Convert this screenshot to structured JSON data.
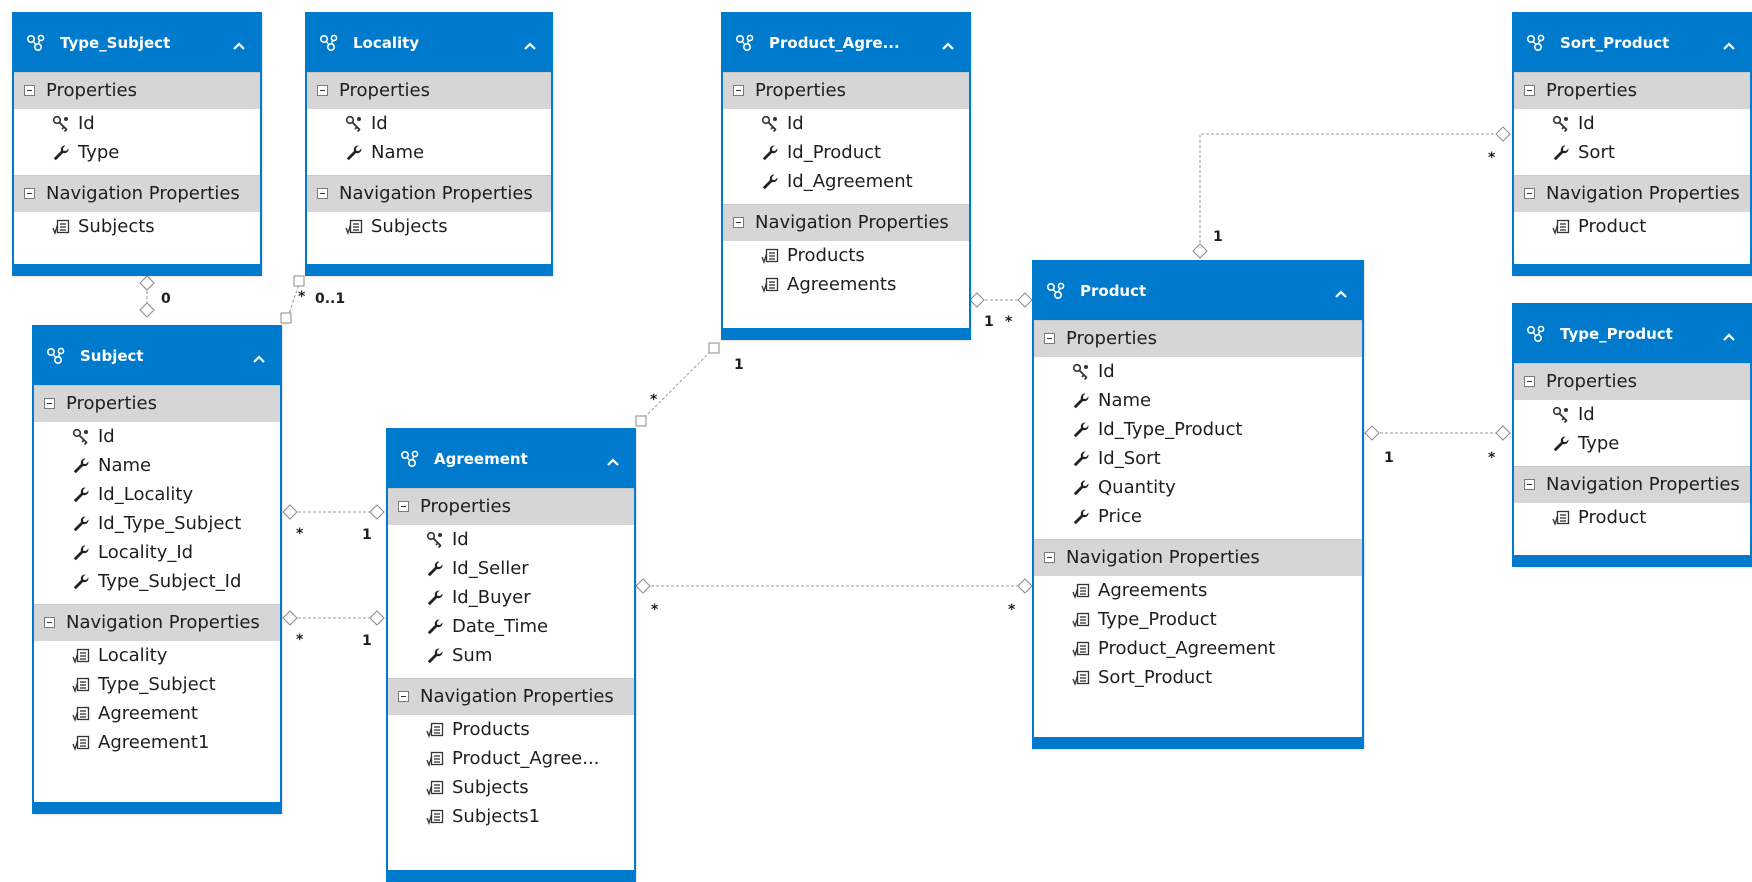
{
  "colors": {
    "accent": "#007acc",
    "section_bg": "#d6d6d6",
    "connector": "#9a9a9a"
  },
  "entities": {
    "Type_Subject": {
      "title": "Type_Subject",
      "properties_label": "Properties",
      "properties": [
        "Id",
        "Type"
      ],
      "navigation_label": "Navigation Properties",
      "navigation": [
        "Subjects"
      ]
    },
    "Locality": {
      "title": "Locality",
      "properties_label": "Properties",
      "properties": [
        "Id",
        "Name"
      ],
      "navigation_label": "Navigation Properties",
      "navigation": [
        "Subjects"
      ]
    },
    "Product_Agreement": {
      "title": "Product_Agre...",
      "properties_label": "Properties",
      "properties": [
        "Id",
        "Id_Product",
        "Id_Agreement"
      ],
      "navigation_label": "Navigation Properties",
      "navigation": [
        "Products",
        "Agreements"
      ]
    },
    "Sort_Product": {
      "title": "Sort_Product",
      "properties_label": "Properties",
      "properties": [
        "Id",
        "Sort"
      ],
      "navigation_label": "Navigation Properties",
      "navigation": [
        "Product"
      ]
    },
    "Subject": {
      "title": "Subject",
      "properties_label": "Properties",
      "properties": [
        "Id",
        "Name",
        "Id_Locality",
        "Id_Type_Subject",
        "Locality_Id",
        "Type_Subject_Id"
      ],
      "navigation_label": "Navigation Properties",
      "navigation": [
        "Locality",
        "Type_Subject",
        "Agreement",
        "Agreement1"
      ]
    },
    "Agreement": {
      "title": "Agreement",
      "properties_label": "Properties",
      "properties": [
        "Id",
        "Id_Seller",
        "Id_Buyer",
        "Date_Time",
        "Sum"
      ],
      "navigation_label": "Navigation Properties",
      "navigation": [
        "Products",
        "Product_Agree...",
        "Subjects",
        "Subjects1"
      ]
    },
    "Product": {
      "title": "Product",
      "properties_label": "Properties",
      "properties": [
        "Id",
        "Name",
        "Id_Type_Product",
        "Id_Sort",
        "Quantity",
        "Price"
      ],
      "navigation_label": "Navigation Properties",
      "navigation": [
        "Agreements",
        "Type_Product",
        "Product_Agreement",
        "Sort_Product"
      ]
    },
    "Type_Product": {
      "title": "Type_Product",
      "properties_label": "Properties",
      "properties": [
        "Id",
        "Type"
      ],
      "navigation_label": "Navigation Properties",
      "navigation": [
        "Product"
      ]
    }
  },
  "associations": [
    {
      "from": "Type_Subject",
      "to": "Subject",
      "from_mult": "",
      "to_mult": "0"
    },
    {
      "from": "Locality",
      "to": "Subject",
      "from_mult": "0..1",
      "to_mult": "*"
    },
    {
      "from": "Subject",
      "to": "Agreement",
      "from_mult": "*",
      "to_mult": "1"
    },
    {
      "from": "Subject",
      "to": "Agreement",
      "from_mult": "*",
      "to_mult": "1"
    },
    {
      "from": "Agreement",
      "to": "Product_Agreement",
      "from_mult": "*",
      "to_mult": "1"
    },
    {
      "from": "Product_Agreement",
      "to": "Product",
      "from_mult": "1",
      "to_mult": "*"
    },
    {
      "from": "Agreement",
      "to": "Product",
      "from_mult": "*",
      "to_mult": "*"
    },
    {
      "from": "Product",
      "to": "Sort_Product",
      "from_mult": "1",
      "to_mult": "*"
    },
    {
      "from": "Product",
      "to": "Type_Product",
      "from_mult": "1",
      "to_mult": "*"
    }
  ]
}
